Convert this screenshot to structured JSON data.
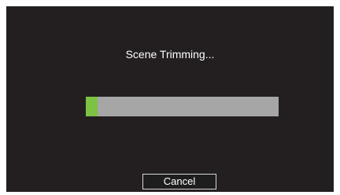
{
  "dialog": {
    "status_text": "Scene Trimming...",
    "progress_fraction": 0.06,
    "cancel_label": "Cancel"
  },
  "colors": {
    "background": "#231f20",
    "track": "#a6a6a6",
    "fill": "#7dc242",
    "text": "#ffffff"
  }
}
